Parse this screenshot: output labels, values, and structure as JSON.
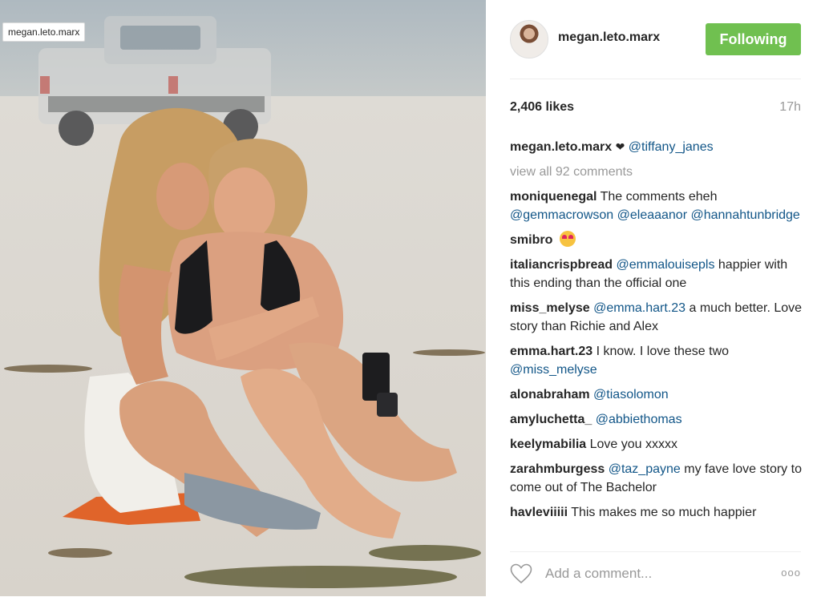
{
  "photo": {
    "tag": "megan.leto.marx"
  },
  "header": {
    "username": "megan.leto.marx",
    "follow_label": "Following"
  },
  "stats": {
    "likes": "2,406 likes",
    "age": "17h"
  },
  "caption": {
    "user": "megan.leto.marx",
    "symbol": "❤",
    "mention": "@tiffany_janes"
  },
  "view_all": "view all 92 comments",
  "comments": [
    {
      "user": "moniquenegal",
      "pre": "The comments eheh",
      "mentions": "@gemmacrowson @eleaaanor @hannahtunbridge",
      "post": ""
    },
    {
      "user": "smibro",
      "pre": "",
      "mentions": "",
      "post": ""
    },
    {
      "user": "italiancrispbread",
      "pre": "",
      "mentions": "@emmalouisepls",
      "post": "happier with this ending than the official one"
    },
    {
      "user": "miss_melyse",
      "pre": "",
      "mentions": "@emma.hart.23",
      "post": "a much better. Love story than Richie and Alex"
    },
    {
      "user": "emma.hart.23",
      "pre": "I know. I love these two",
      "mentions": "@miss_melyse",
      "post": ""
    },
    {
      "user": "alonabraham",
      "pre": "",
      "mentions": "@tiasolomon",
      "post": ""
    },
    {
      "user": "amyluchetta_",
      "pre": "",
      "mentions": "@abbiethomas",
      "post": ""
    },
    {
      "user": "keelymabilia",
      "pre": "Love you xxxxx",
      "mentions": "",
      "post": ""
    },
    {
      "user": "zarahmburgess",
      "pre": "",
      "mentions": "@taz_payne",
      "post": "my fave love story to come out of The Bachelor"
    },
    {
      "user": "havleviiiii",
      "pre": "This makes me so much happier",
      "mentions": "",
      "post": ""
    }
  ],
  "footer": {
    "comment_placeholder": "Add a comment...",
    "more_symbol": "ooo"
  },
  "colors": {
    "follow_green": "#70c050",
    "mention_blue": "#125688",
    "muted": "#999999"
  }
}
